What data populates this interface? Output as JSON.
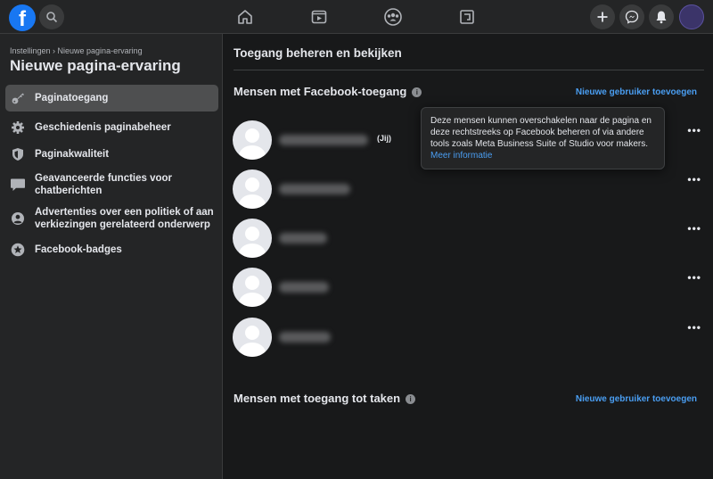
{
  "topbar": {
    "logo": "f",
    "nav_icons": [
      "home-icon",
      "watch-icon",
      "groups-icon",
      "gaming-icon"
    ],
    "right_icons": [
      "plus-icon",
      "messenger-icon",
      "notifications-icon",
      "account-avatar"
    ]
  },
  "sidebar": {
    "breadcrumb": "Instellingen › Nieuwe pagina-ervaring",
    "title": "Nieuwe pagina-ervaring",
    "items": [
      {
        "label": "Paginatoegang",
        "icon": "key-icon",
        "active": true
      },
      {
        "label": "Geschiedenis paginabeheer",
        "icon": "gear-icon",
        "active": false
      },
      {
        "label": "Paginakwaliteit",
        "icon": "shield-icon",
        "active": false
      },
      {
        "label": "Geavanceerde functies voor chatberichten",
        "icon": "chat-bubble-icon",
        "active": false
      },
      {
        "label": "Advertenties over een politiek of aan verkiezingen gerelateerd onderwerp",
        "icon": "person-circle-icon",
        "active": false
      },
      {
        "label": "Facebook-badges",
        "icon": "star-badge-icon",
        "active": false
      }
    ]
  },
  "main": {
    "title": "Toegang beheren en bekijken",
    "section_fb": {
      "title": "Mensen met Facebook-toegang",
      "add_label": "Nieuwe gebruiker toevoegen",
      "people": [
        {
          "suffix": "(Jij)"
        },
        {
          "suffix": ""
        },
        {
          "suffix": ""
        },
        {
          "suffix": ""
        },
        {
          "suffix": ""
        }
      ],
      "more_label": "•••"
    },
    "section_tasks": {
      "title": "Mensen met toegang tot taken",
      "add_label": "Nieuwe gebruiker toevoegen"
    }
  },
  "tooltip": {
    "text": "Deze mensen kunnen overschakelen naar de pagina en deze rechtstreeks op Facebook beheren of via andere tools zoals Meta Business Suite of Studio voor makers.",
    "link": "Meer informatie"
  },
  "colors": {
    "accent": "#1877f2",
    "link": "#4a9ef2",
    "background": "#18191a",
    "surface": "#242526"
  }
}
